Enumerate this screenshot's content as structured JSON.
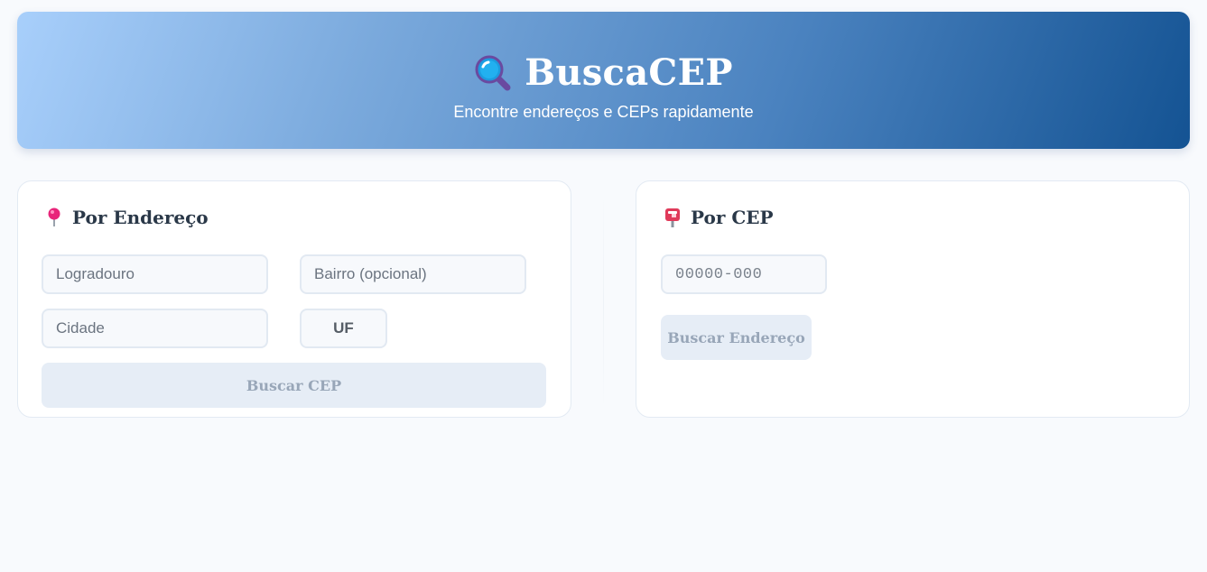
{
  "header": {
    "icon": "magnifying-glass-icon",
    "title": "BuscaCEP",
    "subtitle": "Encontre endereços e CEPs rapidamente",
    "gradient_start": "#a8cffb",
    "gradient_end": "#145393"
  },
  "address_search": {
    "icon": "round-pushpin-icon",
    "heading": "Por Endereço",
    "street_placeholder": "Logradouro",
    "neighborhood_placeholder": "Bairro (opcional)",
    "city_placeholder": "Cidade",
    "state_placeholder": "UF",
    "submit_label": "Buscar CEP"
  },
  "cep_search": {
    "icon": "postbox-icon",
    "heading": "Por CEP",
    "cep_placeholder": "00000-000",
    "submit_label": "Buscar Endereço"
  },
  "colors": {
    "page_background": "#f8fafd",
    "button_disabled_bg": "#e6edf6",
    "button_disabled_text": "#98a6b8",
    "heading_text": "#2a3848"
  }
}
